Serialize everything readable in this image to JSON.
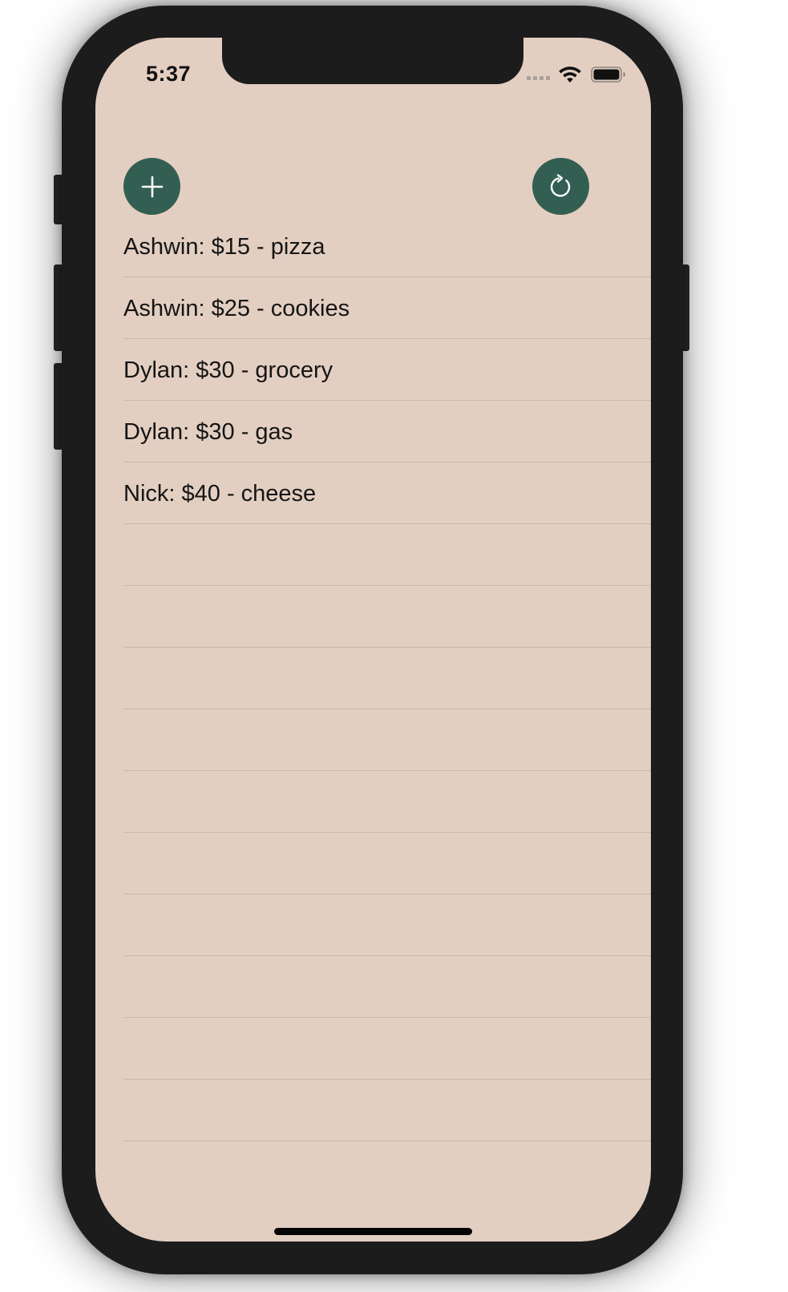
{
  "status_bar": {
    "time": "5:37"
  },
  "icons": {
    "add": "plus-icon",
    "refresh": "refresh-icon",
    "wifi": "wifi-icon",
    "battery": "battery-icon",
    "signal": "signal-dots-icon"
  },
  "colors": {
    "screen_background": "#e3cfc1",
    "fab_background": "#335f52",
    "fab_icon": "#ffffff",
    "row_divider": "#c9b7aa",
    "text": "#151515"
  },
  "expenses": [
    {
      "label": "Ashwin: $15 - pizza"
    },
    {
      "label": "Ashwin: $25 - cookies"
    },
    {
      "label": "Dylan: $30 - grocery"
    },
    {
      "label": "Dylan: $30 - gas"
    },
    {
      "label": "Nick: $40 - cheese"
    },
    {
      "label": ""
    },
    {
      "label": ""
    },
    {
      "label": ""
    },
    {
      "label": ""
    },
    {
      "label": ""
    },
    {
      "label": ""
    },
    {
      "label": ""
    },
    {
      "label": ""
    },
    {
      "label": ""
    },
    {
      "label": ""
    }
  ]
}
